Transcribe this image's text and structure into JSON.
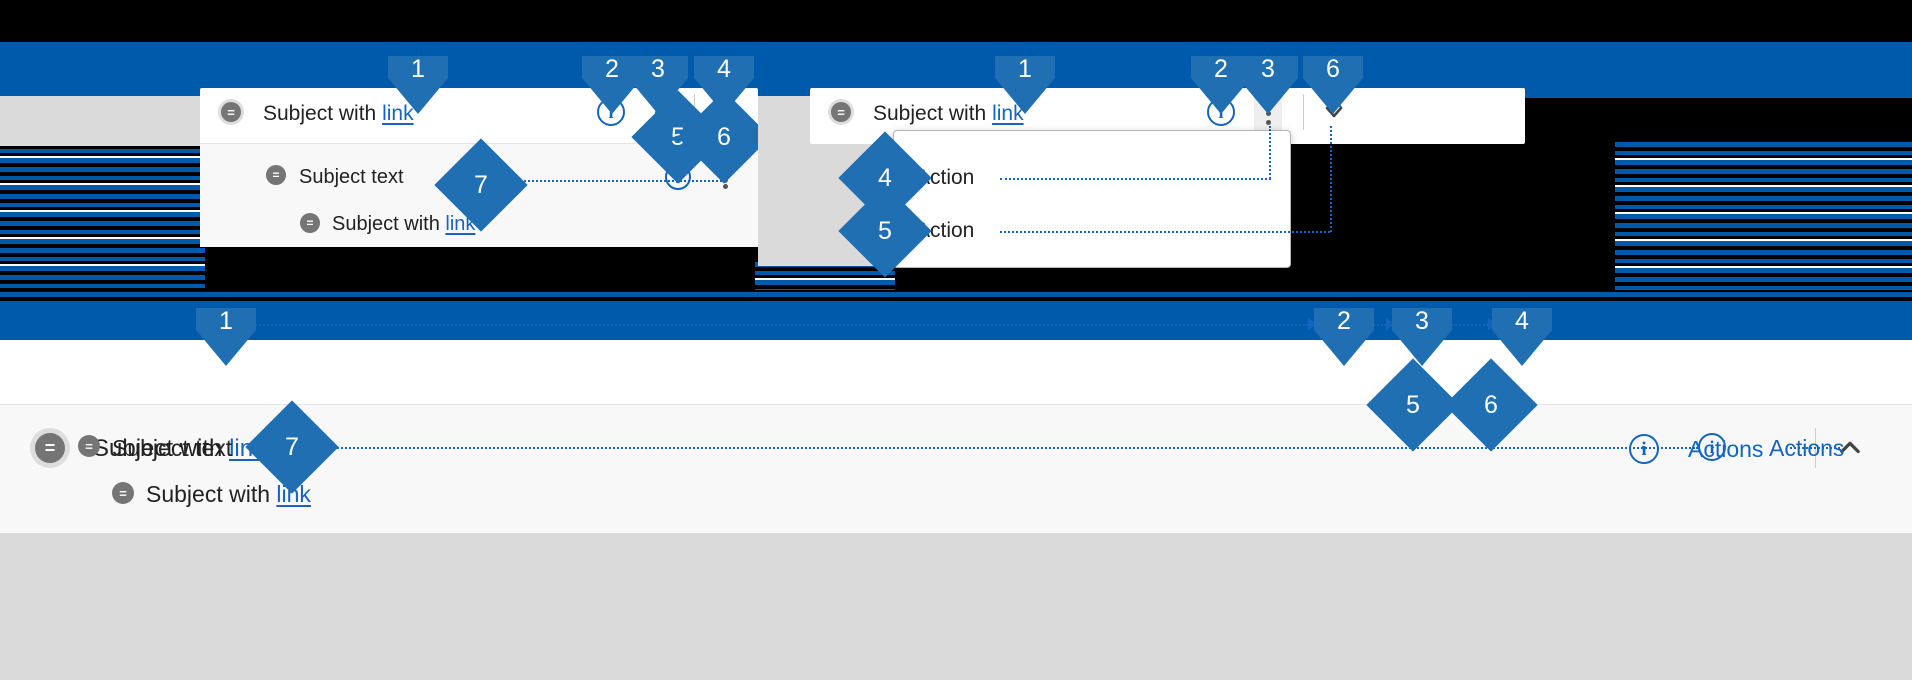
{
  "meta": {
    "accent_blue": "#005aab",
    "callout_blue": "#1f6fb2",
    "link_blue": "#1565c0",
    "card_white": "#ffffff",
    "subrow_gray": "#f8f8f8",
    "panel_gray": "#dadada"
  },
  "icons": {
    "avatar": "avatar-equals-icon",
    "info": "i",
    "kebab": "kebab-menu-icon",
    "chevron_down": "chevron-down-icon",
    "chevron_up": "chevron-up-icon"
  },
  "variants": [
    {
      "id": "collapsed-kebab-card",
      "header": {
        "subject_prefix": "Subject with ",
        "subject_link": "link"
      },
      "rows": [
        {
          "text_prefix": "Subject text",
          "link": ""
        },
        {
          "text_prefix": "Subject with ",
          "link": "link"
        }
      ],
      "callouts": [
        "1",
        "2",
        "3",
        "4",
        "5",
        "6",
        "7"
      ]
    },
    {
      "id": "open-menu-card",
      "header": {
        "subject_prefix": "Subject with ",
        "subject_link": "link"
      },
      "menu": {
        "items": [
          {
            "label": "Action"
          },
          {
            "label": "Action"
          }
        ]
      },
      "callouts": [
        "1",
        "2",
        "3",
        "4",
        "5",
        "6"
      ]
    },
    {
      "id": "expanded-wide-card",
      "header": {
        "subject_prefix": "Subject with ",
        "subject_link": "link",
        "actions_label": "Actions"
      },
      "rows": [
        {
          "text_prefix": "Subject text",
          "link": "",
          "actions_label": "Actions"
        },
        {
          "text_prefix": "Subject with ",
          "link": "link"
        }
      ],
      "callouts": [
        "1",
        "2",
        "3",
        "4",
        "5",
        "6",
        "7"
      ]
    }
  ],
  "callout_numbers": {
    "n1": "1",
    "n2": "2",
    "n3": "3",
    "n4": "4",
    "n5": "5",
    "n6": "6",
    "n7": "7"
  }
}
